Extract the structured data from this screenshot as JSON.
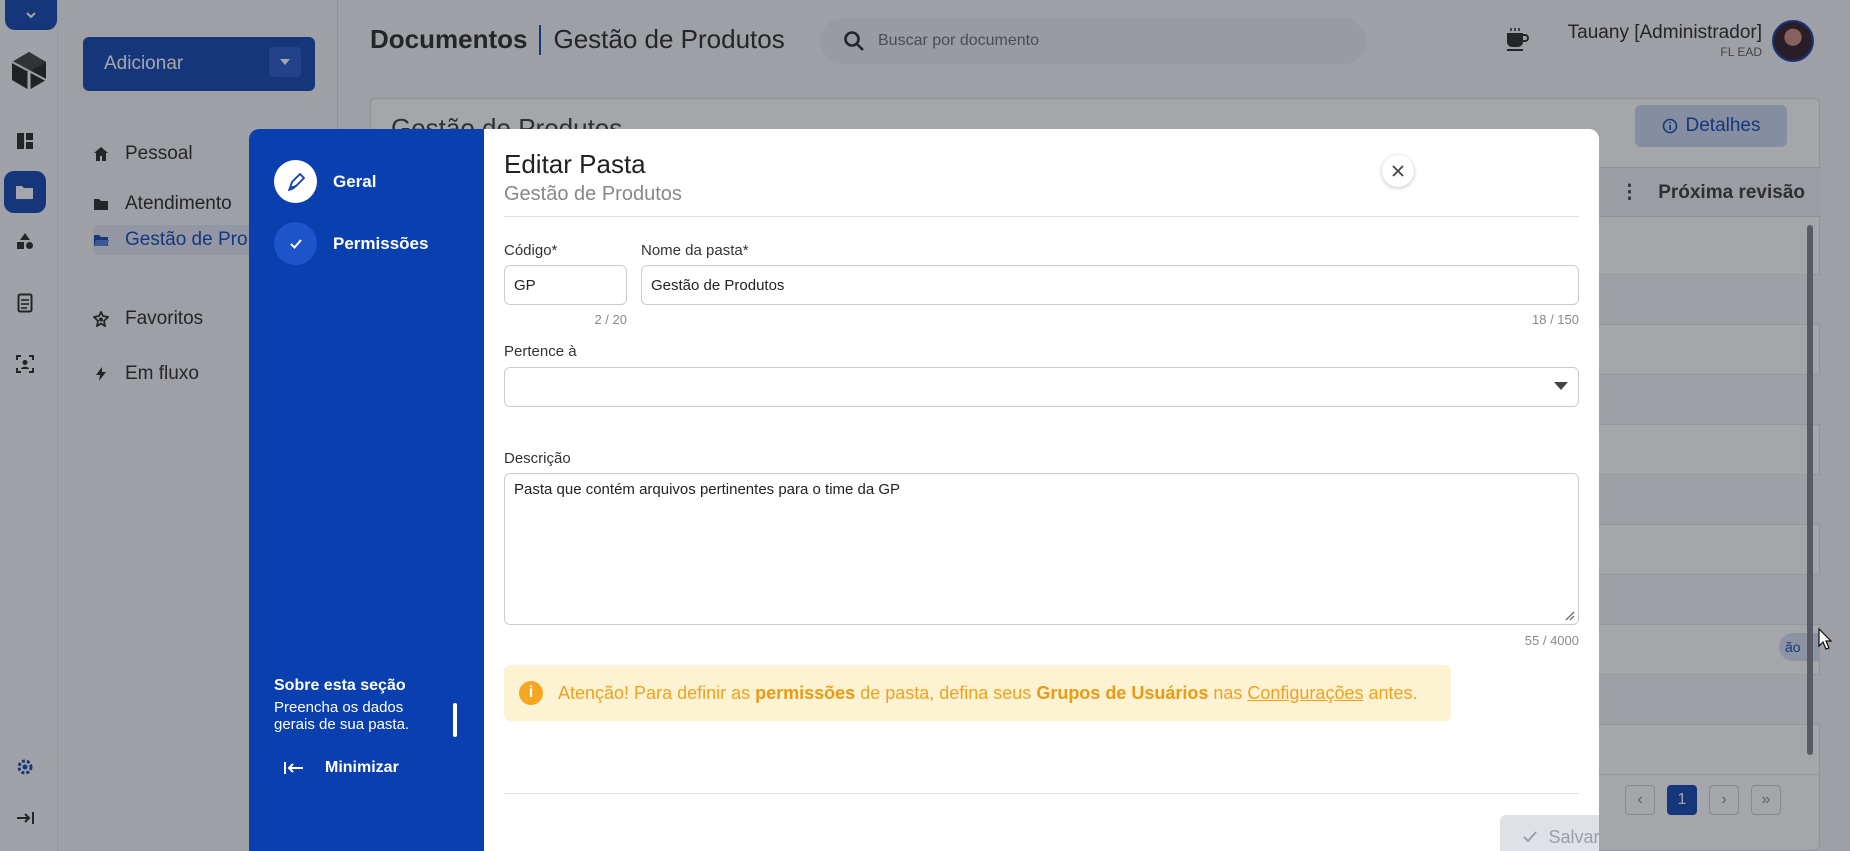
{
  "header": {
    "title_bold": "Documentos",
    "title_rest": "Gestão de Produtos",
    "search_placeholder": "Buscar por documento",
    "user_name": "Tauany [Administrador]",
    "user_org": "FL EAD"
  },
  "sidebar": {
    "add_label": "Adicionar",
    "items": [
      {
        "label": "Pessoal",
        "icon": "home-icon"
      },
      {
        "label": "Atendimento",
        "icon": "folder-icon"
      },
      {
        "label": "Gestão de Pro",
        "icon": "folder-open-icon",
        "active": true
      },
      {
        "label": "Favoritos",
        "icon": "star-badge-icon"
      },
      {
        "label": "Em fluxo",
        "icon": "bolt-icon"
      }
    ]
  },
  "background": {
    "panel_title": "Gestão de Produtos",
    "details_label": "Detalhes",
    "column_header": "Próxima revisão",
    "chip_text": "ão",
    "current_page": "1"
  },
  "modal": {
    "steps": [
      {
        "label": "Geral",
        "icon": "pencil-icon"
      },
      {
        "label": "Permissões",
        "icon": "check-icon"
      }
    ],
    "about_title": "Sobre esta seção",
    "about_desc": "Preencha os dados gerais de sua pasta.",
    "minimize_label": "Minimizar",
    "title": "Editar Pasta",
    "subtitle": "Gestão de Produtos",
    "code_label": "Código*",
    "code_value": "GP",
    "code_counter": "2 / 20",
    "name_label": "Nome da pasta*",
    "name_value": "Gestão de Produtos",
    "name_counter": "18 / 150",
    "parent_label": "Pertence à",
    "parent_value": "",
    "description_label": "Descrição",
    "description_value": "Pasta que contém arquivos pertinentes para o time da GP",
    "description_counter": "55 / 4000",
    "alert": {
      "p1": "Atenção! Para definir as ",
      "b1": "permissões",
      "p2": " de pasta, defina seus ",
      "b2": "Grupos de Usuários",
      "p3": " nas ",
      "link": "Configurações",
      "p4": " antes."
    },
    "save_label": "Salvar"
  },
  "colors": {
    "primary": "#0a3fb0",
    "alert_text": "#f0a11d",
    "alert_bg": "#fdf2d2"
  }
}
